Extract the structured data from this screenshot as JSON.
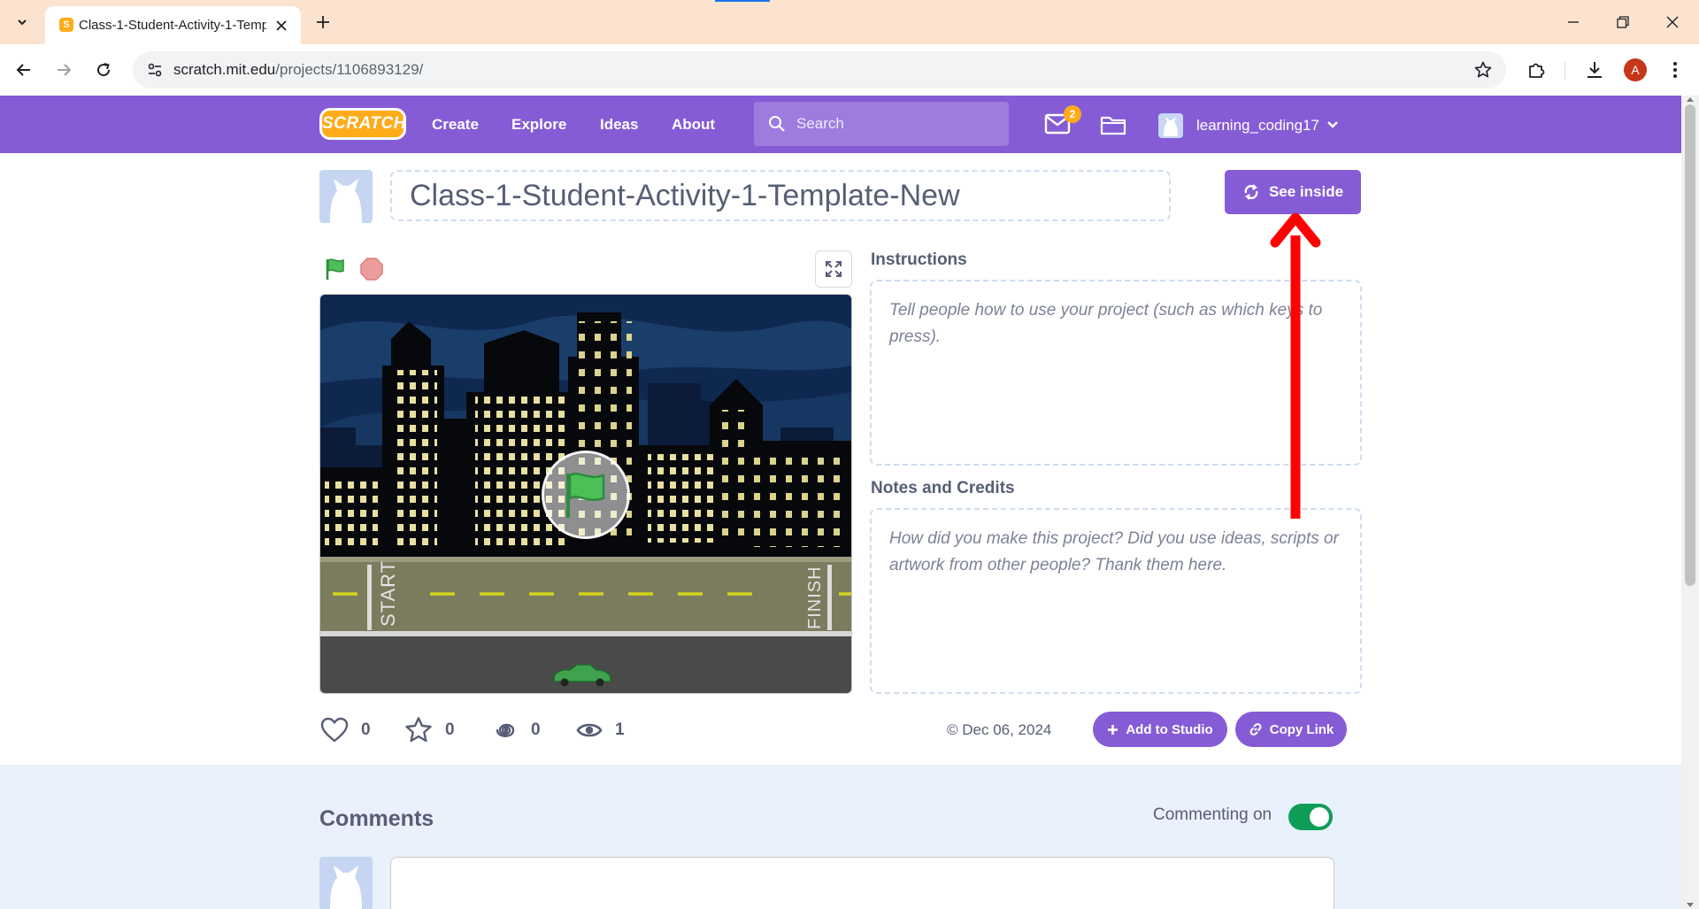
{
  "browser": {
    "tab_title": "Class-1-Student-Activity-1-Temp",
    "tab_favicon": "S",
    "url_host": "scratch.mit.edu",
    "url_path": "/projects/1106893129/",
    "profile_initial": "A"
  },
  "nav": {
    "logo": "SCRATCH",
    "links": [
      "Create",
      "Explore",
      "Ideas",
      "About"
    ],
    "search_placeholder": "Search",
    "messages_count": "2",
    "username": "learning_coding17"
  },
  "project": {
    "title": "Class-1-Student-Activity-1-Template-New",
    "see_inside_label": "See inside",
    "stage_labels": {
      "start": "START",
      "finish": "FINISH"
    },
    "instructions_label": "Instructions",
    "instructions_placeholder": "Tell people how to use your project (such as which keys to press).",
    "notes_label": "Notes and Credits",
    "notes_placeholder": "How did you make this project? Did you use ideas, scripts or artwork from other people? Thank them here.",
    "stats": {
      "loves": "0",
      "favorites": "0",
      "remixes": "0",
      "views": "1"
    },
    "date": "Dec 06, 2024",
    "add_to_studio_label": "Add to Studio",
    "copy_link_label": "Copy Link"
  },
  "comments": {
    "title": "Comments",
    "commenting_label": "Commenting on",
    "commenting_enabled": true
  },
  "colors": {
    "scratch_purple": "#855cd6",
    "scratch_orange": "#ffab1a",
    "toggle_green": "#0f9d58",
    "annotation_red": "#ff0000"
  }
}
